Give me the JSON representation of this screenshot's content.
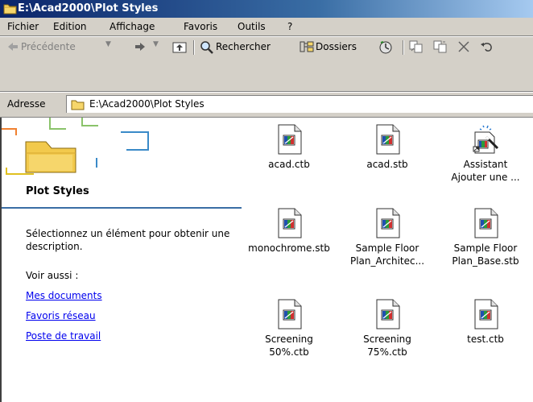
{
  "window": {
    "title": "E:\\Acad2000\\Plot Styles"
  },
  "menu": [
    "Fichier",
    "Edition",
    "Affichage",
    "Favoris",
    "Outils",
    "?"
  ],
  "toolbar": {
    "back": "Précédente",
    "search": "Rechercher",
    "folders": "Dossiers"
  },
  "address": {
    "label": "Adresse",
    "value": "E:\\Acad2000\\Plot Styles"
  },
  "left_pane": {
    "title": "Plot Styles",
    "description": "Sélectionnez un élément pour obtenir une description.",
    "see_also": "Voir aussi :",
    "links": [
      "Mes documents",
      "Favoris réseau",
      "Poste de travail"
    ]
  },
  "files": [
    {
      "line1": "acad.ctb",
      "line2": "",
      "icon": "ctb-file-icon"
    },
    {
      "line1": "acad.stb",
      "line2": "",
      "icon": "stb-file-icon"
    },
    {
      "line1": "Assistant",
      "line2": "Ajouter une ...",
      "icon": "wizard-icon"
    },
    {
      "line1": "monochrome.stb",
      "line2": "",
      "icon": "stb-file-icon"
    },
    {
      "line1": "Sample Floor",
      "line2": "Plan_Architec...",
      "icon": "stb-file-icon"
    },
    {
      "line1": "Sample Floor",
      "line2": "Plan_Base.stb",
      "icon": "stb-file-icon"
    },
    {
      "line1": "Screening",
      "line2": "50%.ctb",
      "icon": "ctb-file-icon"
    },
    {
      "line1": "Screening",
      "line2": "75%.ctb",
      "icon": "ctb-file-icon"
    },
    {
      "line1": "test.ctb",
      "line2": "",
      "icon": "ctb-file-icon"
    }
  ],
  "colors": {
    "titlebar": "#0a246a",
    "link": "#0000ee",
    "face": "#d4d0c8"
  }
}
